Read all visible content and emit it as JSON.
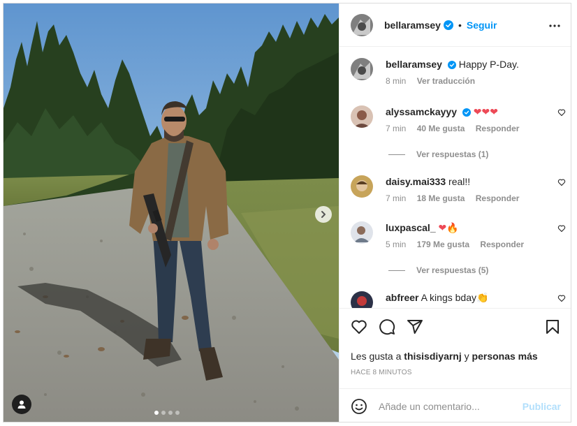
{
  "post": {
    "author": "bellaramsey",
    "follow_label": "Seguir",
    "separator": "•",
    "caption": "Happy P-Day.",
    "caption_time": "8 min",
    "translate_label": "Ver traducción"
  },
  "comments": [
    {
      "user": "alyssamckayyy",
      "verified": true,
      "text": "❤❤❤",
      "time": "7 min",
      "likes": "40 Me gusta",
      "reply": "Responder",
      "view_replies": "Ver respuestas (1)"
    },
    {
      "user": "daisy.mai333",
      "verified": false,
      "text": "real!!",
      "time": "7 min",
      "likes": "18 Me gusta",
      "reply": "Responder",
      "view_replies": ""
    },
    {
      "user": "luxpascal_",
      "verified": false,
      "text": "❤🔥",
      "time": "5 min",
      "likes": "179 Me gusta",
      "reply": "Responder",
      "view_replies": "Ver respuestas (5)"
    },
    {
      "user": "abfreer",
      "verified": false,
      "text": "A kings bday👏",
      "time": "",
      "likes": "",
      "reply": "",
      "view_replies": ""
    }
  ],
  "likes": {
    "prefix": "Les gusta a ",
    "user": "thisisdiyarnj",
    "middle": " y ",
    "others": "personas más"
  },
  "timestamp": "HACE 8 MINUTOS",
  "add_comment": {
    "placeholder": "Añade un comentario...",
    "publish_label": "Publicar"
  },
  "carousel": {
    "slide_count": 4,
    "active_index": 0
  },
  "colors": {
    "accent": "#0095f6",
    "verified": "#0095f6",
    "publish_disabled": "#b2dffc",
    "heart": "#ed4956"
  },
  "icons": [
    "more-options-icon",
    "heart-icon",
    "comment-icon",
    "share-icon",
    "bookmark-icon",
    "emoji-icon",
    "user-tag-icon",
    "chevron-right-icon",
    "verified-badge-icon"
  ]
}
